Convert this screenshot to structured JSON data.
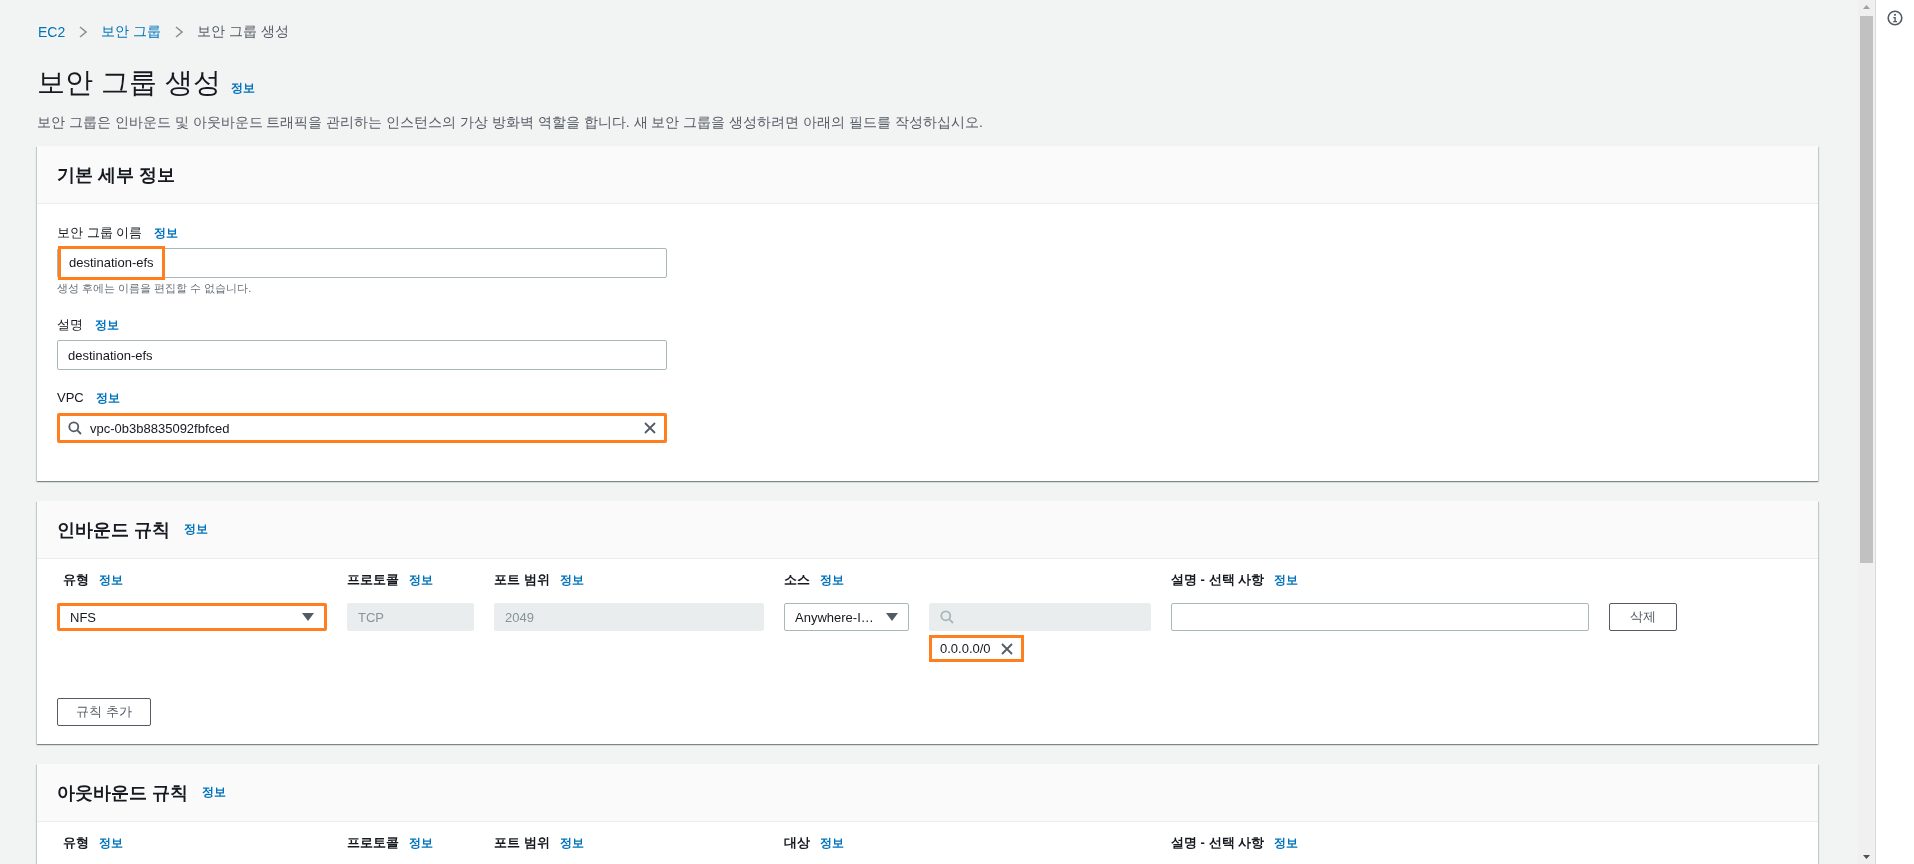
{
  "breadcrumbs": [
    {
      "label": "EC2",
      "link": true
    },
    {
      "label": "보안 그룹",
      "link": true
    },
    {
      "label": "보안 그룹 생성",
      "link": false
    }
  ],
  "page": {
    "title": "보안 그룹 생성",
    "info": "정보",
    "description": "보안 그룹은 인바운드 및 아웃바운드 트래픽을 관리하는 인스턴스의 가상 방화벽 역할을 합니다. 새 보안 그룹을 생성하려면 아래의 필드를 작성하십시오."
  },
  "basic_details": {
    "title": "기본 세부 정보",
    "fields": [
      {
        "kind": "text",
        "label": "보안 그룹 이름",
        "info": "정보",
        "value": "destination-efs",
        "hint": "생성 후에는 이름을 편집할 수 없습니다.",
        "highlighted": true
      },
      {
        "kind": "text",
        "label": "설명",
        "info": "정보",
        "value": "destination-efs",
        "highlighted": false
      },
      {
        "kind": "search",
        "label": "VPC",
        "info": "정보",
        "value": "vpc-0b3b8835092fbfced",
        "highlighted": true
      }
    ]
  },
  "inbound_rules": {
    "title": "인바운드 규칙",
    "info": "정보",
    "columns": [
      {
        "label": "유형",
        "info": "정보"
      },
      {
        "label": "프로토콜",
        "info": "정보"
      },
      {
        "label": "포트 범위",
        "info": "정보"
      },
      {
        "label": "소스",
        "info": "정보"
      },
      {
        "label": "설명 - 선택 사항",
        "info": "정보"
      }
    ],
    "rows": [
      {
        "type": "NFS",
        "type_highlighted": true,
        "protocol": "TCP",
        "port_range": "2049",
        "source": "Anywhere-I…",
        "tokens": [
          {
            "label": "0.0.0.0/0",
            "highlighted": true
          }
        ],
        "delete_button": "삭제"
      }
    ],
    "add_button": "규칙 추가"
  },
  "outbound_rules": {
    "title": "아웃바운드 규칙",
    "info": "정보",
    "columns": [
      {
        "label": "유형",
        "info": "정보"
      },
      {
        "label": "프로토콜",
        "info": "정보"
      },
      {
        "label": "포트 범위",
        "info": "정보"
      },
      {
        "label": "대상",
        "info": "정보"
      },
      {
        "label": "설명 - 선택 사항",
        "info": "정보"
      }
    ]
  }
}
